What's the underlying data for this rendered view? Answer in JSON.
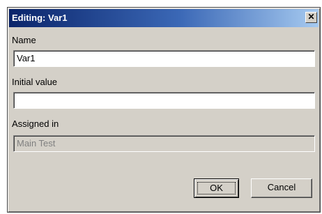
{
  "window": {
    "title": "Editing: Var1",
    "close_glyph": "✕"
  },
  "form": {
    "name_label": "Name",
    "name_value": "Var1",
    "initial_value_label": "Initial value",
    "initial_value_value": "",
    "assigned_in_label": "Assigned in",
    "assigned_in_value": "Main Test"
  },
  "buttons": {
    "ok_label": "OK",
    "cancel_label": "Cancel"
  }
}
